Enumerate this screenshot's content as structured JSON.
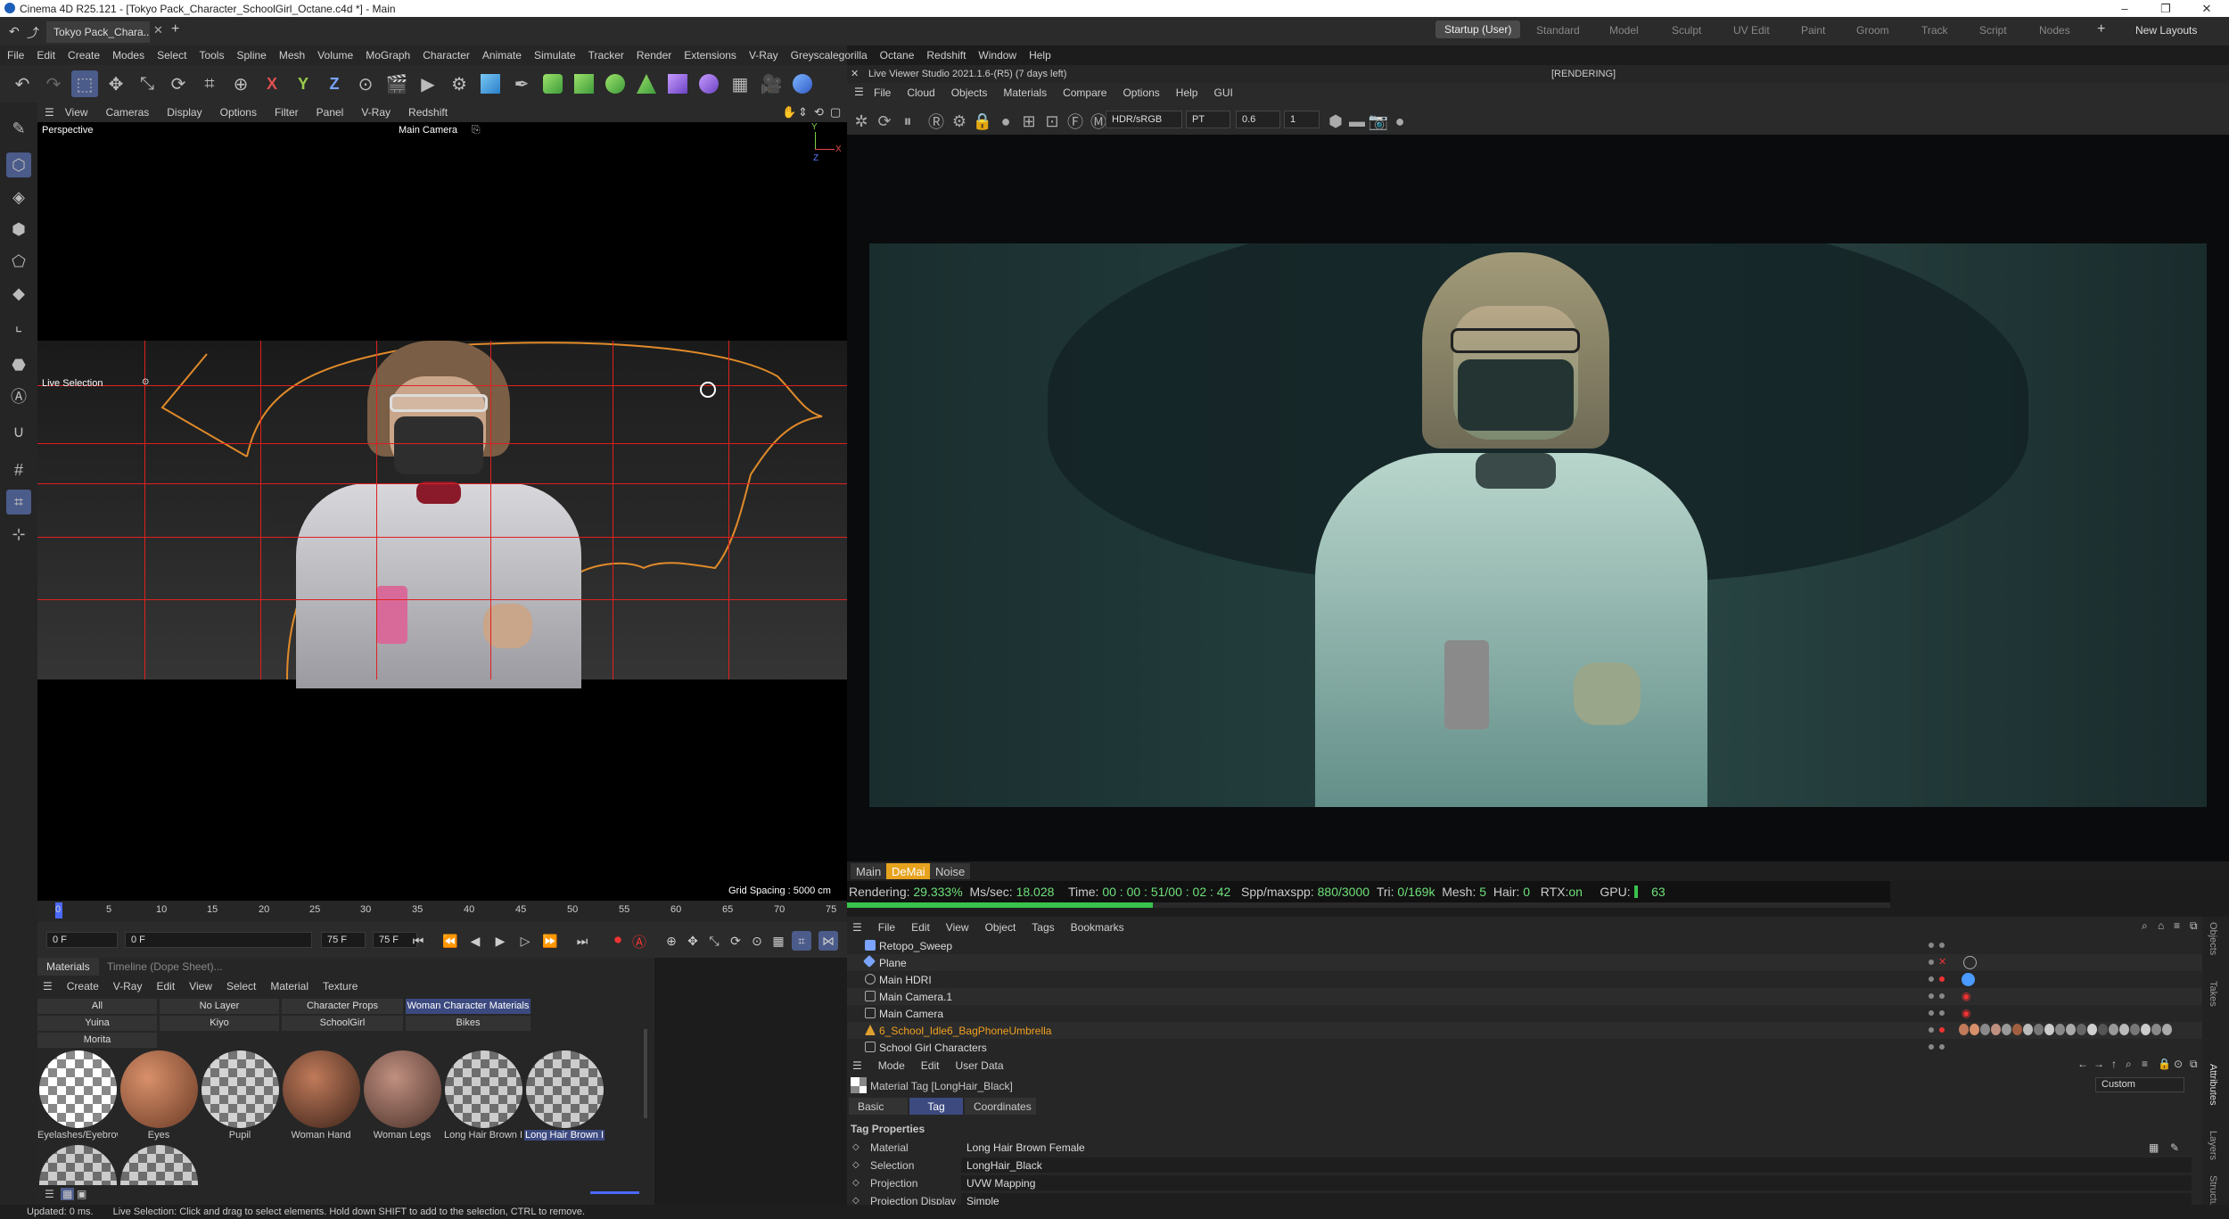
{
  "window": {
    "title": "Cinema 4D R25.121 - [Tokyo Pack_Character_SchoolGirl_Octane.c4d *] - Main",
    "controls": [
      "–",
      "❐",
      "✕"
    ]
  },
  "tabs": {
    "document": "Tokyo Pack_Chara...",
    "layouts": [
      "Startup (User)",
      "Standard",
      "Model",
      "Sculpt",
      "UV Edit",
      "Paint",
      "Groom",
      "Track",
      "Script",
      "Nodes"
    ],
    "active_layout": "Startup (User)",
    "new_layouts": "New Layouts"
  },
  "main_menu": [
    "File",
    "Edit",
    "Create",
    "Modes",
    "Select",
    "Tools",
    "Spline",
    "Mesh",
    "Volume",
    "MoGraph",
    "Character",
    "Animate",
    "Simulate",
    "Tracker",
    "Render",
    "Extensions",
    "V-Ray",
    "Greyscalegorilla",
    "Octane",
    "Redshift",
    "Window",
    "Help"
  ],
  "toolbar": {
    "axis_labels": [
      "X",
      "Y",
      "Z"
    ]
  },
  "viewport": {
    "menu": [
      "View",
      "Cameras",
      "Display",
      "Options",
      "Filter",
      "Panel",
      "V-Ray",
      "Redshift"
    ],
    "projection": "Perspective",
    "camera": "Main Camera",
    "tool_label": "Live Selection",
    "grid_spacing": "Grid Spacing : 5000 cm",
    "axis_y": "Y",
    "axis_x": "X",
    "axis_z": "Z"
  },
  "timeline": {
    "ticks": [
      "0",
      "5",
      "10",
      "15",
      "20",
      "25",
      "30",
      "35",
      "40",
      "45",
      "50",
      "55",
      "60",
      "65",
      "70",
      "75"
    ],
    "current_frame": "0 F",
    "start_frame": "0 F",
    "end_frame": "75 F",
    "end_frame2": "75 F"
  },
  "materials_panel": {
    "tab_active": "Materials",
    "tab_inactive": "Timeline (Dope Sheet)...",
    "menu": [
      "Create",
      "V-Ray",
      "Edit",
      "View",
      "Select",
      "Material",
      "Texture"
    ],
    "layers": [
      "All",
      "No Layer",
      "Character Props",
      "Woman Character Materials",
      "Yuina",
      "Kiyo",
      "SchoolGirl",
      "Bikes",
      "Morita"
    ],
    "highlighted_layer": "Woman Character Materials",
    "materials": [
      {
        "name": "Eyelashes/Eyebrow",
        "kind": "checker"
      },
      {
        "name": "Eyes",
        "kind": "skin"
      },
      {
        "name": "Pupil",
        "kind": "checker"
      },
      {
        "name": "Woman Hand",
        "kind": "hand"
      },
      {
        "name": "Woman Legs",
        "kind": "legs"
      },
      {
        "name": "Long Hair Brown I",
        "kind": "hair"
      },
      {
        "name": "Long Hair Brown I",
        "kind": "hair",
        "selected": true
      }
    ]
  },
  "status_bar": {
    "updated": "Updated: 0 ms.",
    "hint": "Live Selection: Click and drag to select elements. Hold down SHIFT to add to the selection, CTRL to remove."
  },
  "live_viewer": {
    "title": "Live Viewer Studio 2021.1.6-(R5) (7 days left)",
    "state": "[RENDERING]",
    "menu": [
      "File",
      "Cloud",
      "Objects",
      "Materials",
      "Compare",
      "Options",
      "Help",
      "GUI"
    ],
    "colorspace": "HDR/sRGB",
    "kernel": "PT",
    "exposure": "0.6",
    "value2": "1",
    "render_tabs": [
      "Main",
      "DeMai",
      "Noise"
    ],
    "active_render_tab": "DeMai"
  },
  "render_stats": {
    "rendering_label": "Rendering:",
    "rendering": "29.333%",
    "ms_label": "Ms/sec:",
    "ms": "18.028",
    "time_label": "Time:",
    "time": "00 : 00 : 51/00 : 02 : 42",
    "spp_label": "Spp/maxspp:",
    "spp": "880/3000",
    "tri_label": "Tri:",
    "tri": "0/169k",
    "mesh_label": "Mesh:",
    "mesh": "5",
    "hair_label": "Hair:",
    "hair": "0",
    "rtx_label": "RTX:",
    "rtx": "on",
    "gpu_label": "GPU:",
    "gpu": "63",
    "progress": 0.293
  },
  "object_manager": {
    "menu": [
      "File",
      "Edit",
      "View",
      "Object",
      "Tags",
      "Bookmarks"
    ],
    "objects": [
      {
        "name": "Retopo_Sweep",
        "color": "#7aa4ff"
      },
      {
        "name": "Plane",
        "color": "#7aa4ff"
      },
      {
        "name": "Main HDRI",
        "color": "#aaa"
      },
      {
        "name": "Main Camera.1",
        "color": "#aaa"
      },
      {
        "name": "Main Camera",
        "color": "#aaa"
      },
      {
        "name": "6_School_Idle6_BagPhoneUmbrella",
        "color": "#e0a030",
        "highlight": true
      },
      {
        "name": "School Girl Characters",
        "color": "#aaa"
      }
    ]
  },
  "attribute_manager": {
    "menu": [
      "Mode",
      "Edit",
      "User Data"
    ],
    "header": "Material Tag [LongHair_Black]",
    "preset": "Custom",
    "tabs": [
      "Basic",
      "Tag",
      "Coordinates"
    ],
    "active_tab": "Tag",
    "section": "Tag Properties",
    "fields": [
      {
        "label": "Material",
        "value": "Long Hair Brown Female"
      },
      {
        "label": "Selection",
        "value": "LongHair_Black"
      },
      {
        "label": "Projection",
        "value": "UVW Mapping"
      },
      {
        "label": "Projection Display",
        "value": "Simple"
      }
    ]
  },
  "side_tabs": [
    "Objects",
    "Takes",
    "Attributes",
    "Layers",
    "Structure"
  ]
}
